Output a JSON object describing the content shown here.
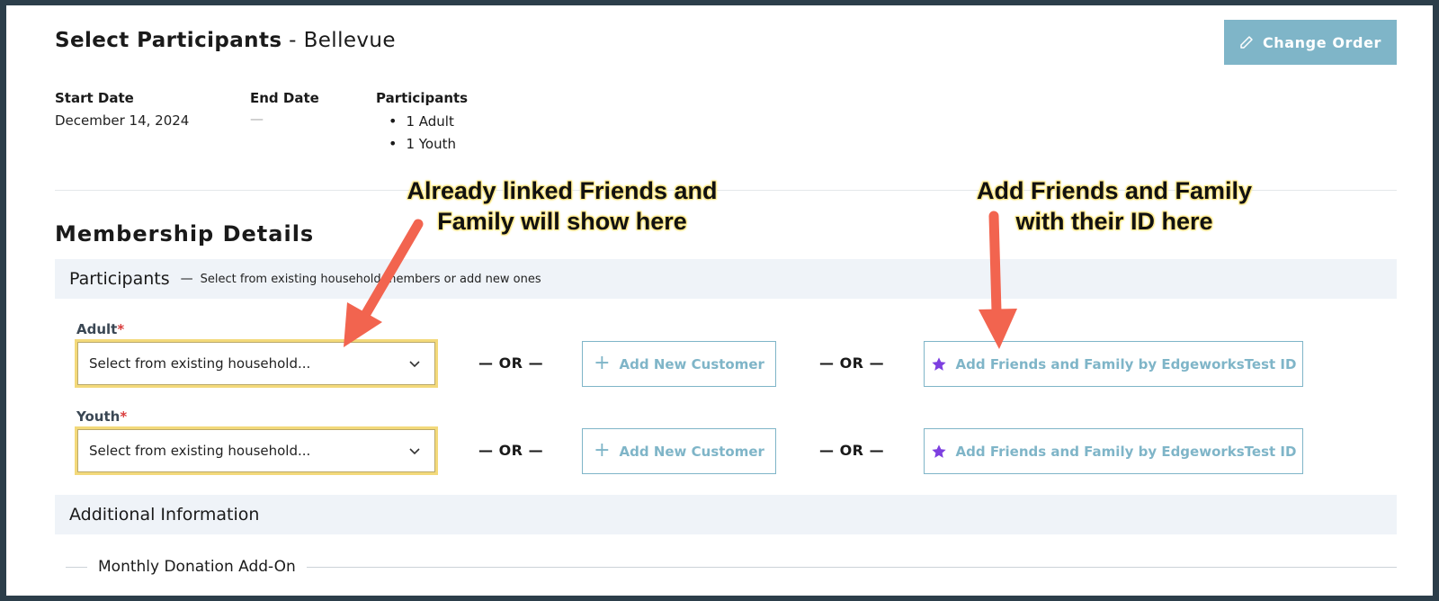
{
  "header": {
    "title": "Select Participants",
    "separator": " - ",
    "location": "Bellevue",
    "change_order_label": "Change Order"
  },
  "summary": {
    "start_date_label": "Start Date",
    "start_date_value": "December 14, 2024",
    "end_date_label": "End Date",
    "end_date_value": "—",
    "participants_label": "Participants",
    "participants": [
      "1 Adult",
      "1 Youth"
    ]
  },
  "membership": {
    "section_title": "Membership Details",
    "participants_band_title": "Participants",
    "participants_band_dash": "—",
    "participants_band_sub": "Select from existing household members or add new ones",
    "rows": [
      {
        "label": "Adult",
        "required_mark": "*",
        "select_value": "Select from existing household...",
        "or_1": "— OR —",
        "add_customer": "Add New Customer",
        "or_2": "— OR —",
        "add_friends": "Add Friends and Family by EdgeworksTest ID"
      },
      {
        "label": "Youth",
        "required_mark": "*",
        "select_value": "Select from existing household...",
        "or_1": "— OR —",
        "add_customer": "Add New Customer",
        "or_2": "— OR —",
        "add_friends": "Add Friends and Family by EdgeworksTest ID"
      }
    ],
    "additional_info_title": "Additional Information",
    "monthly_donation_label": "Monthly Donation Add-On"
  },
  "annotations": {
    "left_line_1": "Already linked Friends and",
    "left_line_2": "Family will show here",
    "right_line_1": "Add Friends and Family",
    "right_line_2": "with their ID here"
  },
  "colors": {
    "accent": "#7fb5c8",
    "star": "#7d3fe0",
    "required": "#d93c3c",
    "select_highlight": "#f3d97a",
    "arrow": "#f2644f",
    "band_bg": "#eff3f8"
  }
}
